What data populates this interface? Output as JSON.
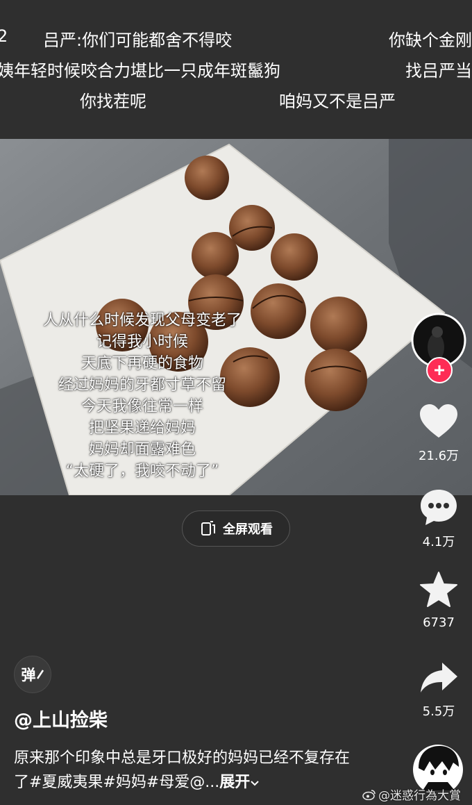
{
  "danmaku": [
    {
      "text": "2",
      "row": 1
    },
    {
      "text": "吕严:你们可能都舍不得咬",
      "row": 1
    },
    {
      "text": "你缺个金刚",
      "row": 1
    },
    {
      "text": "姨年轻时候咬合力堪比一只成年斑鬣狗",
      "row": 2
    },
    {
      "text": "找吕严当",
      "row": 2
    },
    {
      "text": "你找茬呢",
      "row": 3
    },
    {
      "text": "咱妈又不是吕严",
      "row": 3
    }
  ],
  "video_caption": [
    "人从什么时候发现父母变老了",
    "记得我小时候",
    "天底下再硬的食物",
    "经过妈妈的牙都寸草不留",
    "今天我像往常一样",
    "把坚果递给妈妈",
    "妈妈却面露难色",
    "“太硬了，我咬不动了”"
  ],
  "fullscreen_label": "全屏观看",
  "sidebar": {
    "likes": "21.6万",
    "comments": "4.1万",
    "favorites": "6737",
    "shares": "5.5万"
  },
  "danmaku_toggle_label": "弹",
  "author": "@上山捡柴",
  "description": "原来那个印象中总是牙口极好的妈妈已经不复存在了#夏威夷果#妈妈#母爱@...",
  "expand_label": "展开",
  "watermark": "@迷惑行為大賞",
  "colors": {
    "accent": "#fe2c55",
    "background": "#2f2f2f"
  }
}
